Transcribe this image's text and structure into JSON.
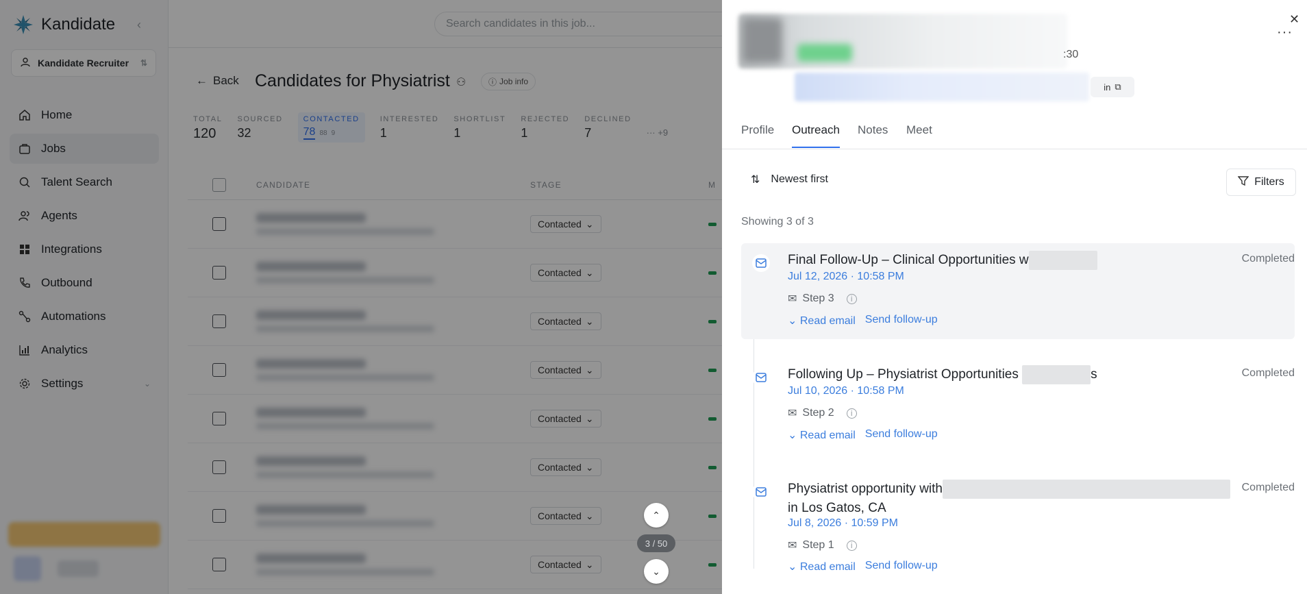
{
  "sidebar": {
    "brand": "Kandidate",
    "workspace": "Kandidate Recruiter",
    "items": [
      {
        "label": "Home"
      },
      {
        "label": "Jobs"
      },
      {
        "label": "Talent Search"
      },
      {
        "label": "Agents"
      },
      {
        "label": "Integrations"
      },
      {
        "label": "Outbound"
      },
      {
        "label": "Automations"
      },
      {
        "label": "Analytics"
      },
      {
        "label": "Settings"
      }
    ]
  },
  "main": {
    "search_placeholder": "Search candidates in this job...",
    "back_label": "Back",
    "title": "Candidates for Physiatrist",
    "job_info_label": "Job info",
    "stats": [
      {
        "label": "TOTAL",
        "value": "120"
      },
      {
        "label": "SOURCED",
        "value": "32"
      },
      {
        "label": "CONTACTED",
        "value": "78",
        "sub_a": "88",
        "sub_b": "9"
      },
      {
        "label": "INTERESTED",
        "value": "1"
      },
      {
        "label": "SHORTLIST",
        "value": "1"
      },
      {
        "label": "REJECTED",
        "value": "1"
      },
      {
        "label": "DECLINED",
        "value": "7"
      }
    ],
    "more_stats": "+9",
    "columns": {
      "candidate": "CANDIDATE",
      "stage": "STAGE",
      "more": "M"
    },
    "row_stage": "Contacted",
    "pager": {
      "count": "3 / 50"
    }
  },
  "panel": {
    "time_fragment": ":30",
    "tabs": [
      {
        "label": "Profile"
      },
      {
        "label": "Outreach"
      },
      {
        "label": "Notes"
      },
      {
        "label": "Meet"
      }
    ],
    "sort_label": "Newest first",
    "filters_label": "Filters",
    "showing": "Showing 3 of 3",
    "items": [
      {
        "subject": "Final Follow-Up – Clinical Opportunities w",
        "date": "Jul 12, 2026 · 10:58 PM",
        "step": "Step 3",
        "read": "Read email",
        "followup": "Send follow-up",
        "status": "Completed"
      },
      {
        "subject": "Following Up – Physiatrist Opportunities",
        "subject_tail": "s",
        "date": "Jul 10, 2026 · 10:58 PM",
        "step": "Step 2",
        "read": "Read email",
        "followup": "Send follow-up",
        "status": "Completed"
      },
      {
        "subject": "Physiatrist opportunity with",
        "subject_line2": "in Los Gatos, CA",
        "date": "Jul 8, 2026 · 10:59 PM",
        "step": "Step 1",
        "read": "Read email",
        "followup": "Send follow-up",
        "status": "Completed"
      }
    ]
  }
}
